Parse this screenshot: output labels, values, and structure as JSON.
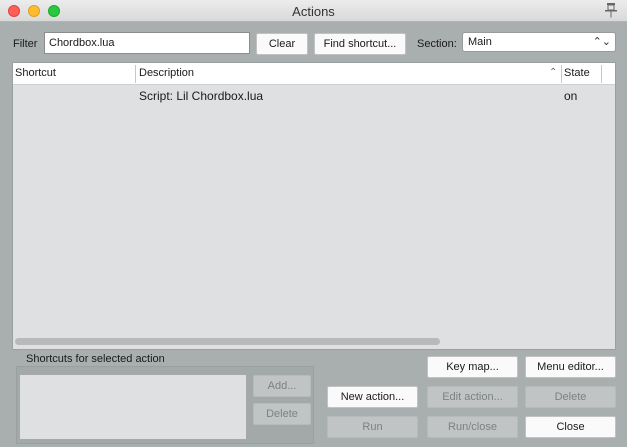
{
  "window": {
    "title": "Actions"
  },
  "filter": {
    "label": "Filter",
    "value": "Chordbox.lua"
  },
  "buttons": {
    "clear": "Clear",
    "find_shortcut": "Find shortcut...",
    "add": "Add...",
    "delete_shortcut": "Delete",
    "new_action": "New action...",
    "run": "Run",
    "key_map": "Key map...",
    "edit_action": "Edit action...",
    "run_close": "Run/close",
    "menu_editor": "Menu editor...",
    "delete_action": "Delete",
    "close": "Close"
  },
  "section": {
    "label": "Section:",
    "value": "Main"
  },
  "table": {
    "columns": [
      "Shortcut",
      "Description",
      "State"
    ],
    "rows": [
      {
        "shortcut": "",
        "description": "Script: Lil Chordbox.lua",
        "state": "on"
      }
    ]
  },
  "shortcuts_group": {
    "title": "Shortcuts for selected action"
  }
}
